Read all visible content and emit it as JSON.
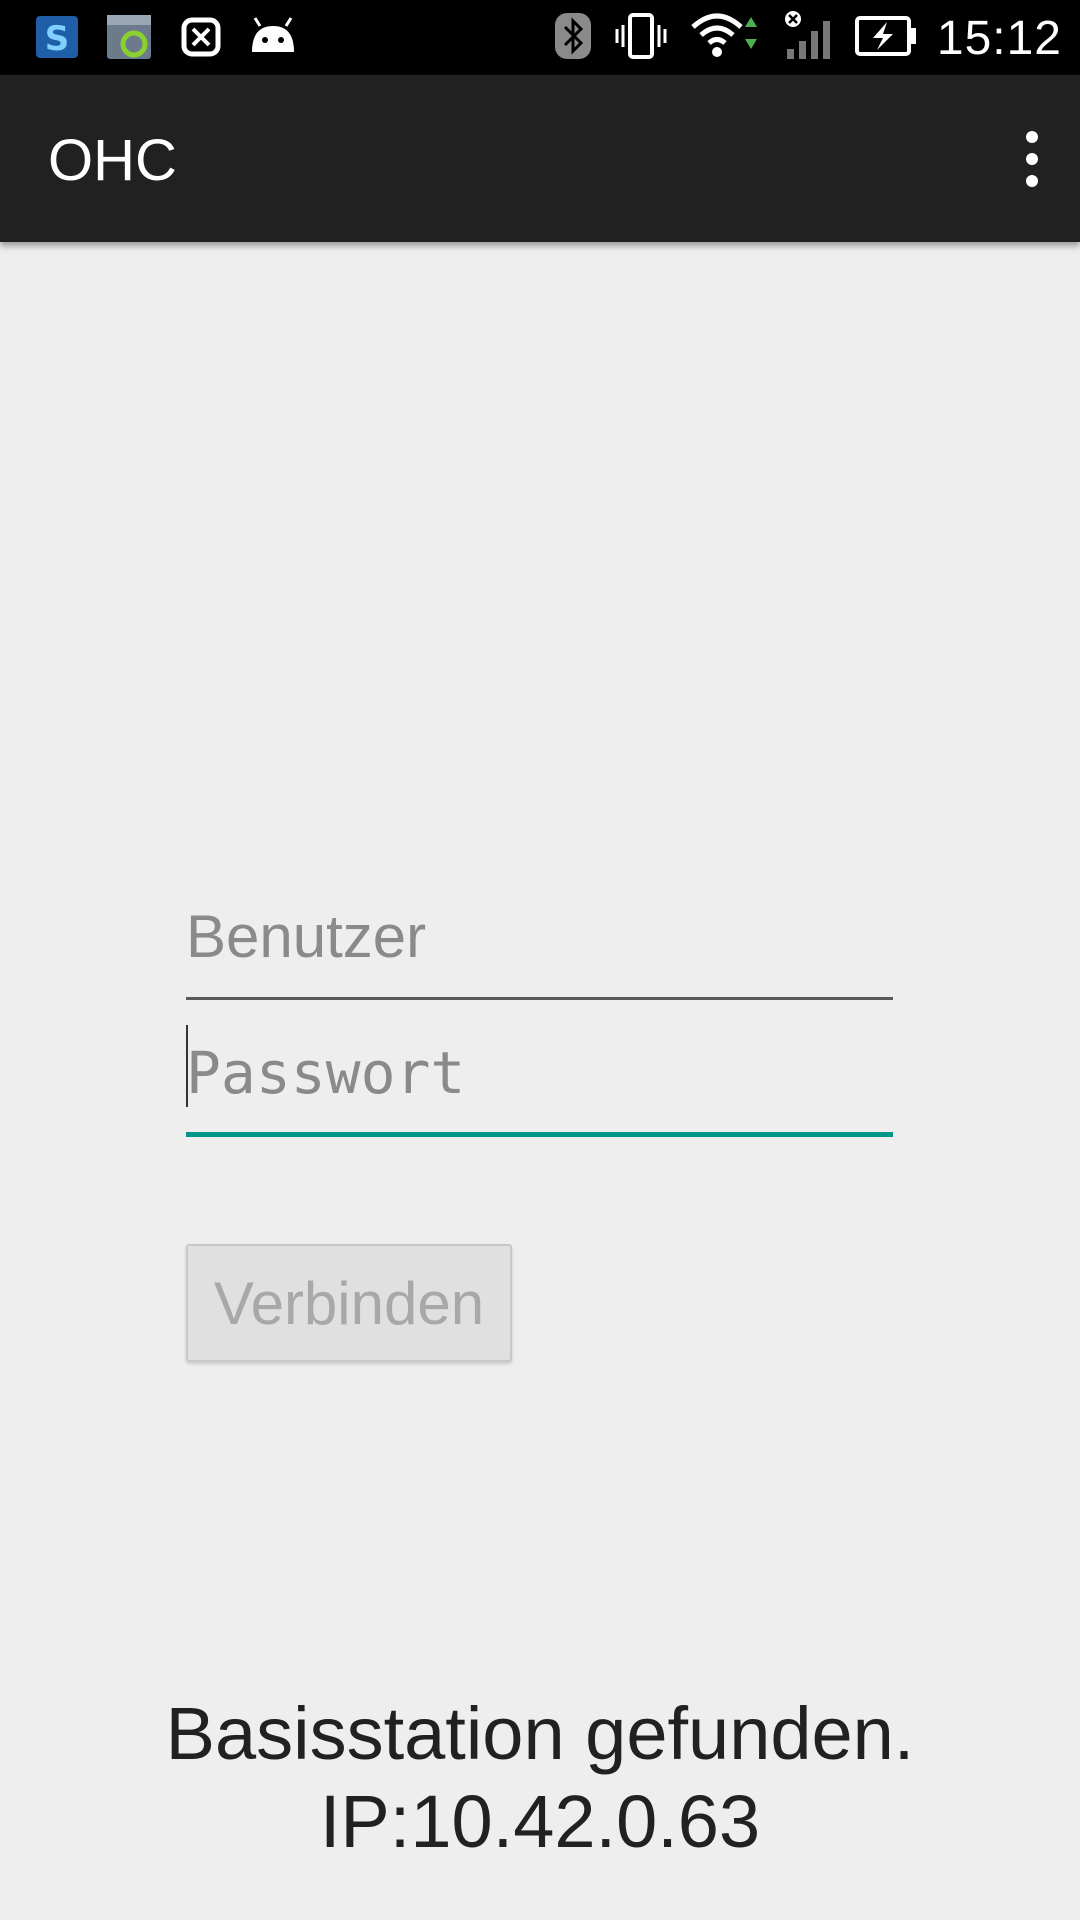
{
  "status_bar": {
    "time": "15:12",
    "left_icons": [
      "s-app-icon",
      "sync-app-icon",
      "smartwatch-icon",
      "android-icon"
    ],
    "right_icons": [
      "bluetooth-icon",
      "vibrate-icon",
      "wifi-icon",
      "signal-icon",
      "battery-charging-icon"
    ]
  },
  "action_bar": {
    "title": "OHC",
    "menu_icon": "overflow-menu-icon"
  },
  "login": {
    "username_placeholder": "Benutzer",
    "password_placeholder": "Passwort",
    "connect_label": "Verbinden"
  },
  "status": {
    "line1": "Basisstation gefunden.",
    "line2": "IP:10.42.0.63"
  },
  "colors": {
    "accent": "#009688",
    "action_bar": "#212121",
    "background": "#eeeeee"
  }
}
